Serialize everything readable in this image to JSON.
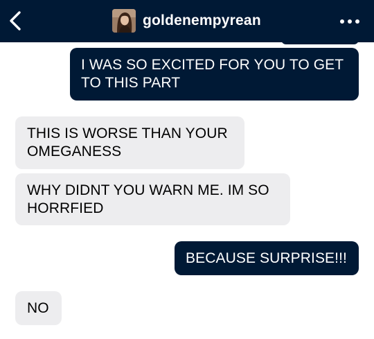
{
  "header": {
    "blog_name": "goldenempyrean",
    "back_icon": "chevron-left-icon",
    "more_icon": "ellipsis-icon",
    "background": "#001935"
  },
  "messages": [
    {
      "direction": "sent",
      "text": "I WAS SO EXCITED FOR YOU TO GET\nTO THIS PART"
    },
    {
      "direction": "received",
      "text": "THIS IS WORSE THAN YOUR\nOMEGANESS"
    },
    {
      "direction": "received",
      "text": "WHY DIDNT YOU WARN ME. IM SO\nHORRFIED"
    },
    {
      "direction": "sent",
      "text": "BECAUSE SURPRISE!!!"
    },
    {
      "direction": "received",
      "text": "NO"
    }
  ],
  "colors": {
    "sent_bubble": "#001935",
    "received_bubble": "#ededef"
  }
}
